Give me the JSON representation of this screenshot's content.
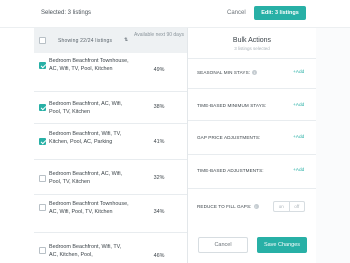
{
  "topbar": {
    "selected_text": "Selected: 3 listings",
    "cancel_label": "Cancel",
    "edit_label": "Edit: 3 listings"
  },
  "list_header": {
    "showing": "Showing 22/24 listings",
    "sort_icon": "sort-icon",
    "available_label": "Available next 90 days"
  },
  "listings": [
    {
      "name": "Bedroom Beachfront Townhouse, AC, Wifi, TV, Pool, Kitchen",
      "pct": "49%",
      "checked": true
    },
    {
      "name": "Bedroom Beachfront, AC, Wifi, Pool, TV, Kitchen",
      "pct": "38%",
      "checked": true
    },
    {
      "name": "Bedroom Beachfront, Wifi, TV, Kitchen, Pool, AC, Parking",
      "pct": "41%",
      "checked": true
    },
    {
      "name": "Bedroom Beachfront, AC, Wifi, Pool, TV, Kitchen",
      "pct": "32%",
      "checked": false
    },
    {
      "name": "Bedroom Beachfront Townhouse, AC, Wifi, Pool, TV, Kitchen",
      "pct": "34%",
      "checked": false
    },
    {
      "name": "Bedroom Beachfront, Wifi, TV, AC, Kitchen, Pool,",
      "pct": "46%",
      "checked": false
    }
  ],
  "bulk": {
    "title": "Bulk Actions",
    "subtitle": "3 listings selected",
    "seasonal_min_stays": "SEASONAL MIN STAYS:",
    "time_based_min_stays": "TIME-BASED MINIMUM STAYS:",
    "gap_price": "GAP PRICE ADJUSTMENTS:",
    "time_based_adjust": "TIME-BASED ADJUSTMENTS:",
    "reduce_gaps": "REDUCE TO FILL GAPS:",
    "add_label": "+Add",
    "info_glyph": "i",
    "toggle_on": "on",
    "toggle_off": "off",
    "cancel_label": "Cancel",
    "save_label": "Save Changes"
  },
  "colors": {
    "accent": "#28b0a6"
  }
}
